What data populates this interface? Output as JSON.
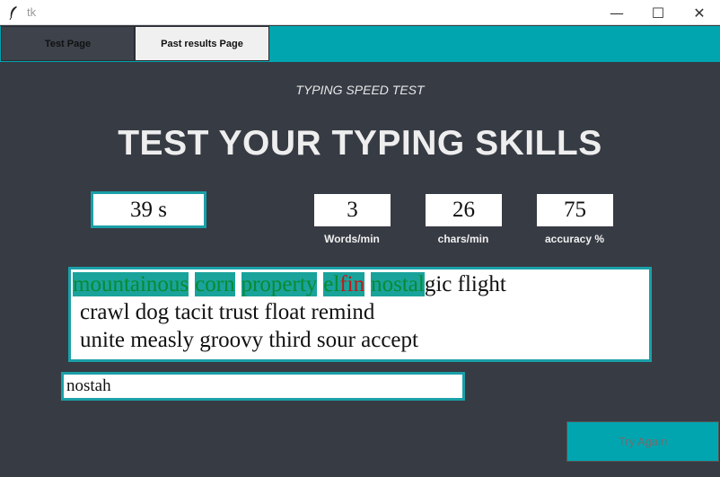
{
  "window": {
    "title": "tk",
    "controls": {
      "minimize": "—",
      "maximize": "☐",
      "close": "✕"
    }
  },
  "tabs": [
    {
      "label": "Test Page"
    },
    {
      "label": "Past results Page"
    }
  ],
  "page": {
    "subtitle": "TYPING SPEED TEST",
    "headline": "TEST YOUR TYPING SKILLS"
  },
  "timer": {
    "value": "39 s"
  },
  "stats": {
    "words_per_min": {
      "value": "3",
      "label": "Words/min"
    },
    "chars_per_min": {
      "value": "26",
      "label": "chars/min"
    },
    "accuracy": {
      "value": "75",
      "label": "accuracy %"
    }
  },
  "passage": {
    "line1": {
      "typed_words": [
        "mountainous",
        "corn",
        "property"
      ],
      "partial_word": {
        "correct_prefix": "el",
        "incorrect": "fin"
      },
      "current_word": {
        "typed": "nostal",
        "remaining": "gic"
      },
      "rest": " flight"
    },
    "line2": "crawl dog tacit trust float remind",
    "line3": "unite measly groovy third sour accept"
  },
  "entry": {
    "value": "nostah"
  },
  "try_again": {
    "label": "Try Again"
  },
  "colors": {
    "background": "#373b44",
    "accent": "#00a5b0",
    "correct_text": "#0a8a32",
    "incorrect_text": "#c01818"
  }
}
